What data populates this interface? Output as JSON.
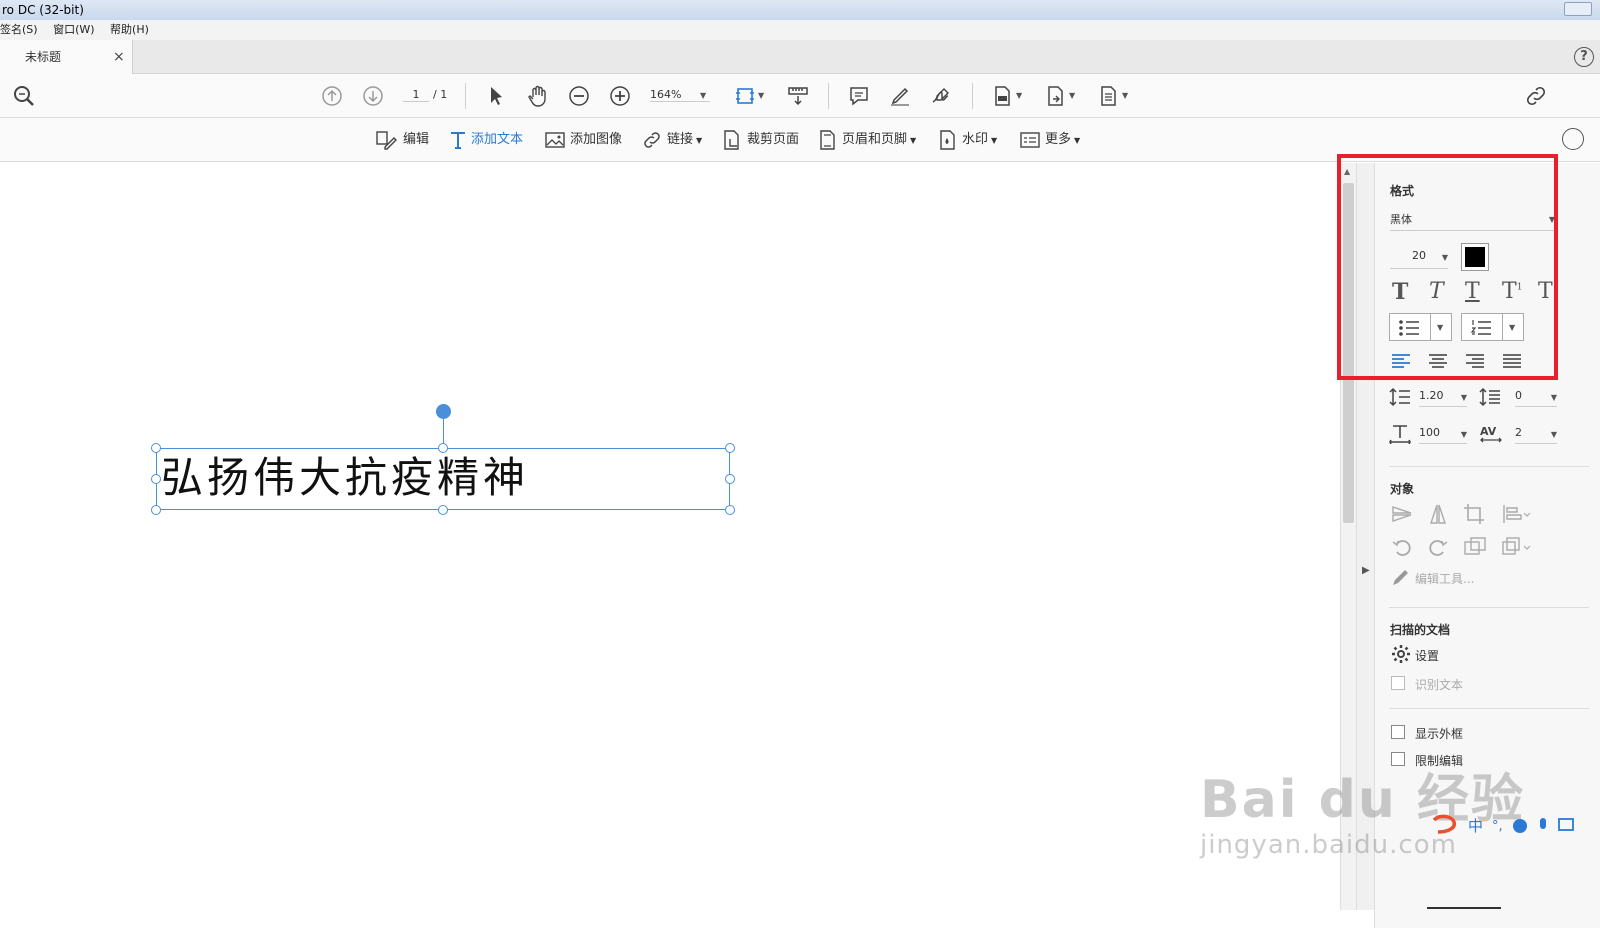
{
  "window": {
    "title": "ro DC (32-bit)"
  },
  "menu": {
    "items": [
      "签名(S)",
      "窗口(W)",
      "帮助(H)"
    ]
  },
  "tab": {
    "label": "未标题",
    "close": "×"
  },
  "help": {
    "label": "?"
  },
  "toolbar": {
    "page_current": "1",
    "page_total": "/ 1",
    "zoom": "164%"
  },
  "edit_toolbar": {
    "edit": "编辑",
    "add_text": "添加文本",
    "add_image": "添加图像",
    "link": "链接",
    "crop": "裁剪页面",
    "header_footer": "页眉和页脚",
    "watermark": "水印",
    "more": "更多"
  },
  "document": {
    "text": "弘扬伟大抗疫精神"
  },
  "panel": {
    "format_title": "格式",
    "font": "黑体",
    "font_size": "20",
    "text_color": "#000000",
    "line_spacing": "1.20",
    "paragraph_spacing": "0",
    "horizontal_scale": "100",
    "char_spacing": "2",
    "objects_title": "对象",
    "edit_tools": "编辑工具...",
    "scanned_title": "扫描的文档",
    "settings": "设置",
    "recognize_text": "识别文本",
    "show_bbox": "显示外框",
    "restrict_edit": "限制编辑"
  },
  "watermark": {
    "main": "Bai du 经验",
    "sub": "jingyan.baidu.com"
  },
  "colors": {
    "accent": "#4a90d9",
    "highlight": "#e8202e"
  }
}
